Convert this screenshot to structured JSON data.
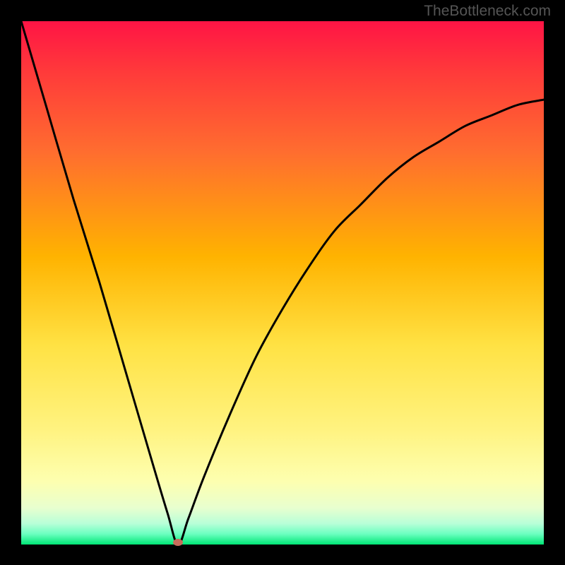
{
  "watermark": "TheBottleneck.com",
  "colors": {
    "bg": "#000000",
    "gradient_top": "#ff1744",
    "gradient_mid1": "#ff6d2f",
    "gradient_mid2": "#ffb300",
    "gradient_mid3": "#ffe244",
    "gradient_mid4": "#fff380",
    "gradient_mid5": "#f3ffb3",
    "gradient_bottom": "#00e676",
    "curve": "#000000",
    "marker": "#c76b5b"
  },
  "chart_data": {
    "type": "line",
    "title": "",
    "xlabel": "",
    "ylabel": "",
    "xlim": [
      0,
      100
    ],
    "ylim": [
      0,
      100
    ],
    "series": [
      {
        "name": "curve",
        "x": [
          0,
          5,
          10,
          15,
          20,
          25,
          28,
          30,
          32,
          35,
          40,
          45,
          50,
          55,
          60,
          65,
          70,
          75,
          80,
          85,
          90,
          95,
          100
        ],
        "y": [
          100,
          83,
          66,
          50,
          33,
          16,
          6,
          0,
          5,
          13,
          25,
          36,
          45,
          53,
          60,
          65,
          70,
          74,
          77,
          80,
          82,
          84,
          85
        ]
      }
    ],
    "optimal_x": 30,
    "marker": {
      "x": 30,
      "y": 0
    }
  }
}
